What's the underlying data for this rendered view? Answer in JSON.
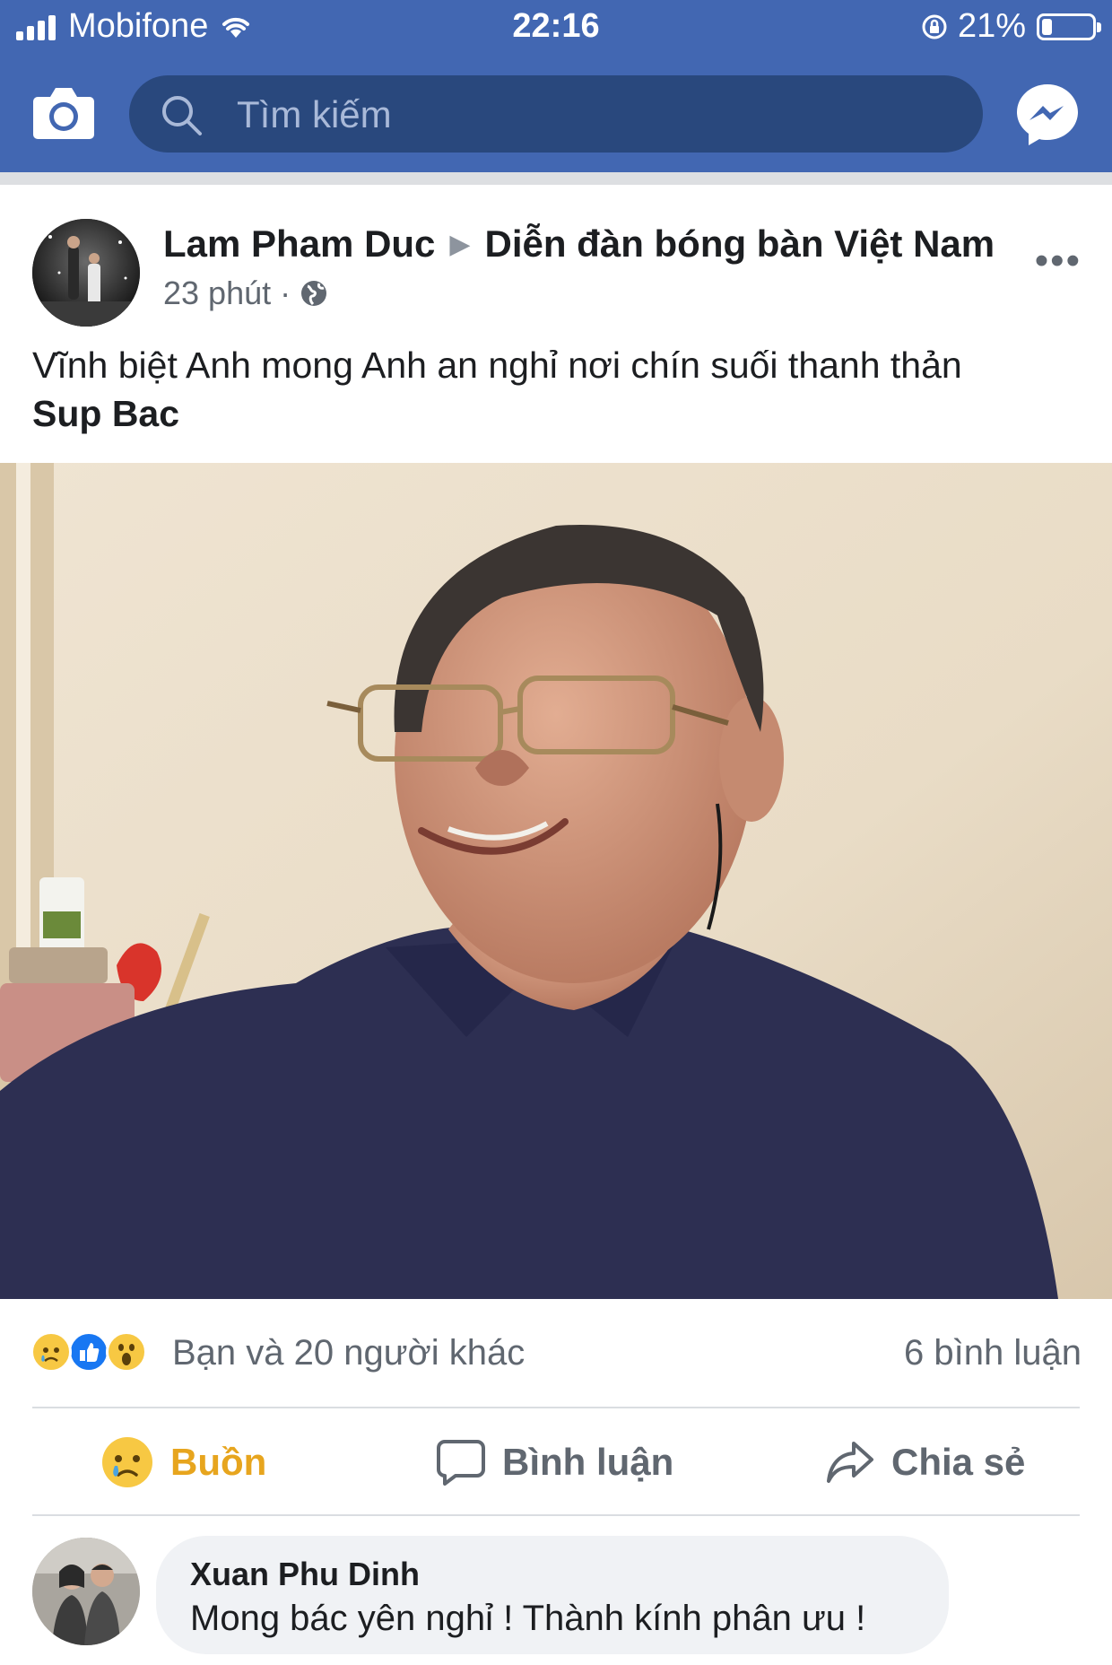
{
  "status_bar": {
    "carrier": "Mobifone",
    "time": "22:16",
    "battery": "21%",
    "battery_level": 0.21
  },
  "header": {
    "search_placeholder": "Tìm kiếm",
    "camera_icon": "camera-icon",
    "messenger_icon": "messenger-icon",
    "brand_color": "#4267b2"
  },
  "post": {
    "author": "Lam Pham Duc",
    "group": "Diễn đàn bóng bàn Việt Nam",
    "time": "23 phút",
    "audience_icon": "globe-icon",
    "text": "Vĩnh biệt Anh mong Anh an nghỉ nơi chín suối thanh thản",
    "tag": "Sup Bac",
    "reactions": [
      "sad",
      "like",
      "wow"
    ],
    "reaction_summary": "Bạn và 20 người khác",
    "comment_count": "6 bình luận"
  },
  "actions": {
    "react": "Buồn",
    "comment": "Bình luận",
    "share": "Chia sẻ"
  },
  "comment": {
    "author": "Xuan Phu Dinh",
    "text": "Mong bác yên nghỉ ! Thành kính phân ưu !"
  }
}
